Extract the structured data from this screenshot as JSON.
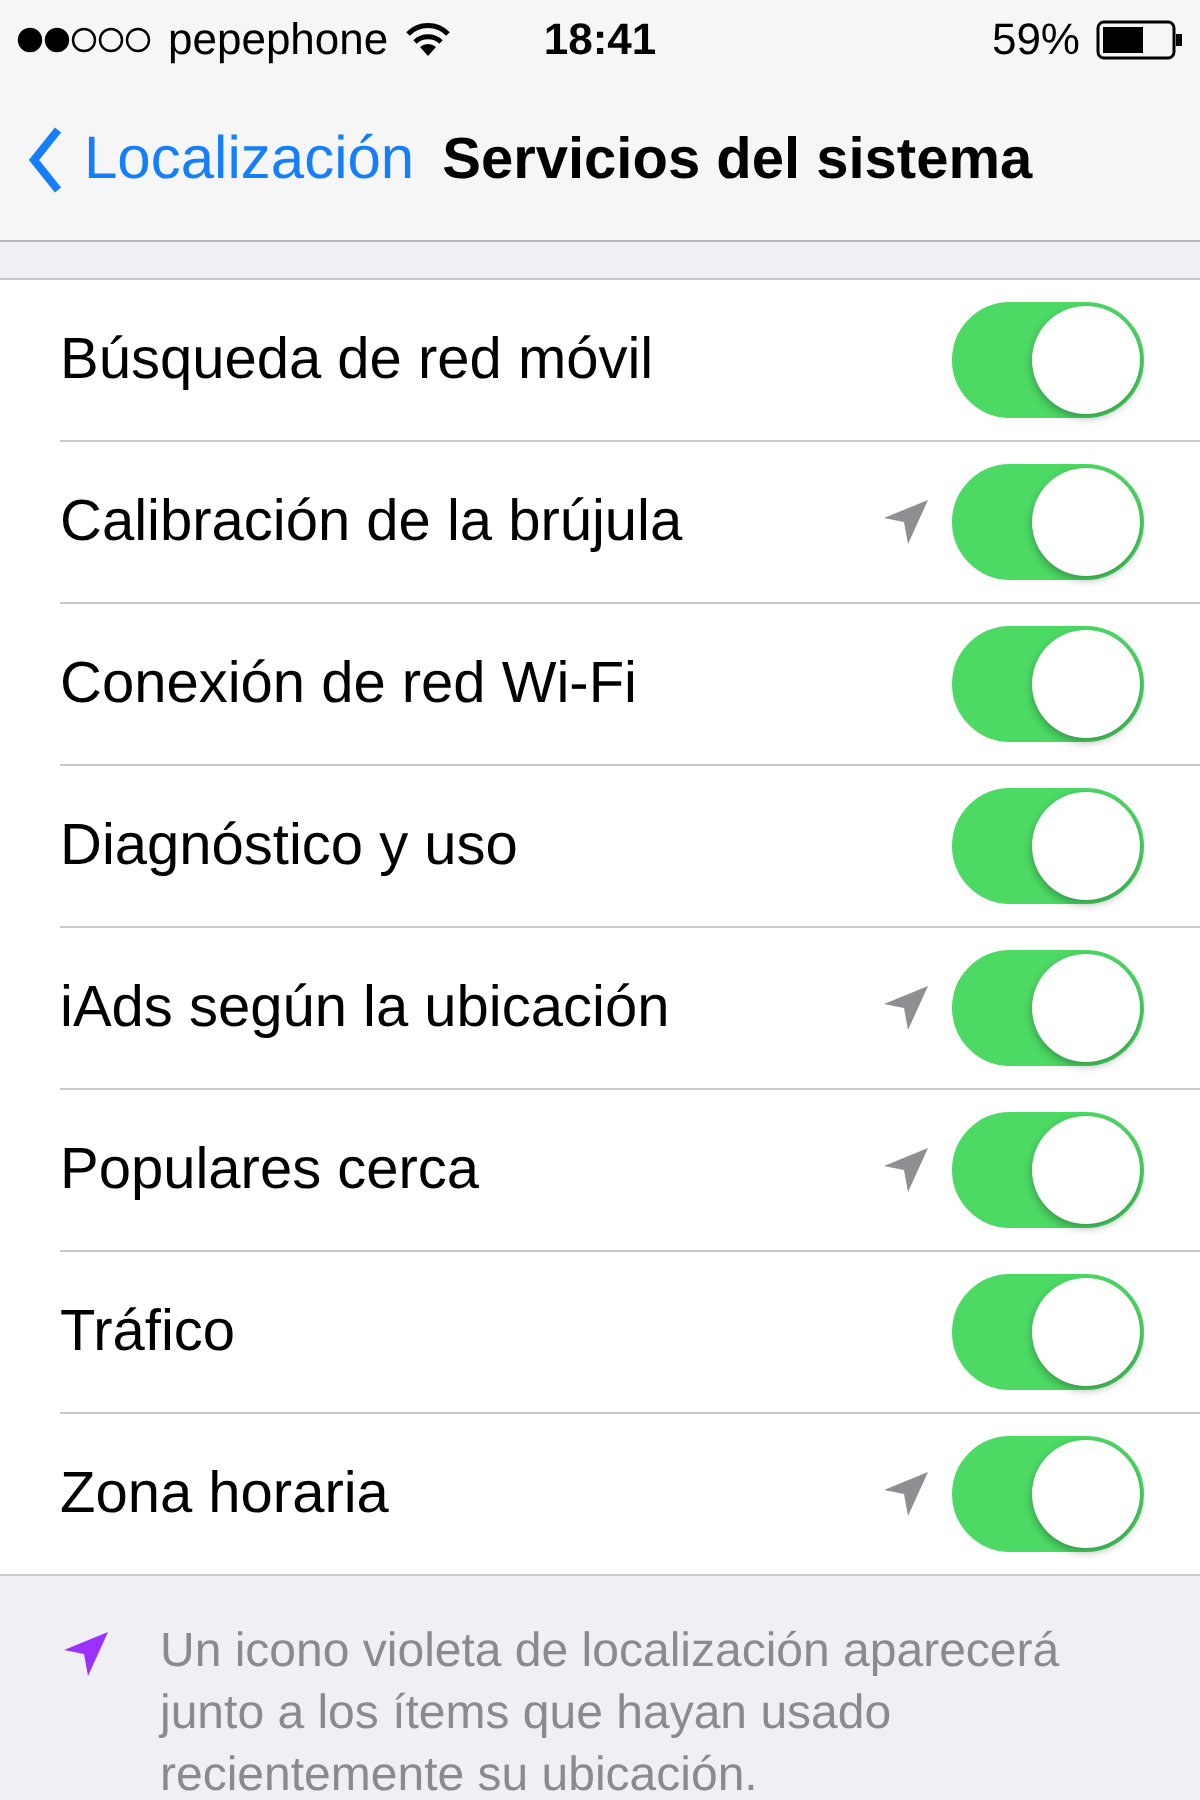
{
  "status_bar": {
    "carrier": "pepephone",
    "time": "18:41",
    "battery": "59%"
  },
  "nav": {
    "back": "Localización",
    "title": "Servicios del sistema"
  },
  "rows": [
    {
      "label": "Búsqueda de red móvil",
      "location_used": false,
      "on": true
    },
    {
      "label": "Calibración de la brújula",
      "location_used": true,
      "on": true
    },
    {
      "label": "Conexión de red Wi-Fi",
      "location_used": false,
      "on": true
    },
    {
      "label": "Diagnóstico y uso",
      "location_used": false,
      "on": true
    },
    {
      "label": "iAds según la ubicación",
      "location_used": true,
      "on": true
    },
    {
      "label": "Populares cerca",
      "location_used": true,
      "on": true
    },
    {
      "label": "Tráfico",
      "location_used": false,
      "on": true
    },
    {
      "label": "Zona horaria",
      "location_used": true,
      "on": true
    }
  ],
  "footer": {
    "lines": [
      "Un icono violeta de localización aparecerá",
      "junto a los ítems que hayan usado",
      "recientemente su ubicación."
    ]
  }
}
